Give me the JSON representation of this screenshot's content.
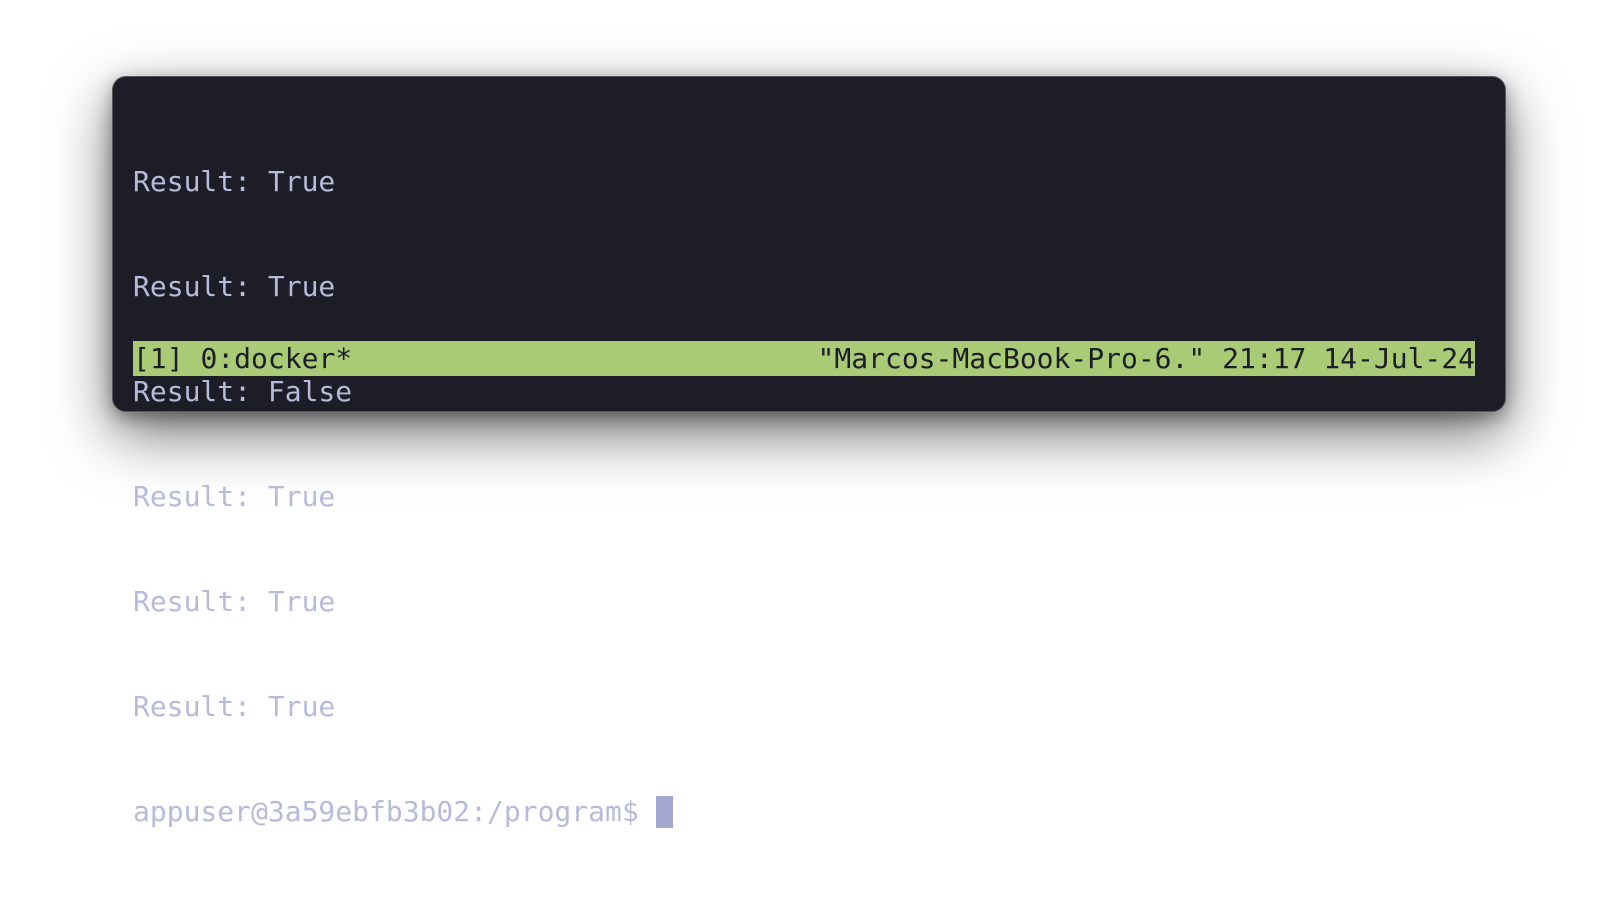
{
  "terminal": {
    "output_lines": [
      "Result: True",
      "Result: True",
      "Result: False",
      "Result: True",
      "Result: True",
      "Result: True"
    ],
    "prompt": "appuser@3a59ebfb3b02:/program$"
  },
  "status_bar": {
    "session": "[1]",
    "window": "0:docker*",
    "hostname": "\"Marcos-MacBook-Pro-6.\"",
    "time": "21:17",
    "date": "14-Jul-24"
  },
  "colors": {
    "terminal_background": "#1d1d27",
    "terminal_text": "#b6bbd9",
    "cursor": "#a4a8d1",
    "status_bar_background": "#a9cb76",
    "status_bar_text": "#1d1d27"
  }
}
